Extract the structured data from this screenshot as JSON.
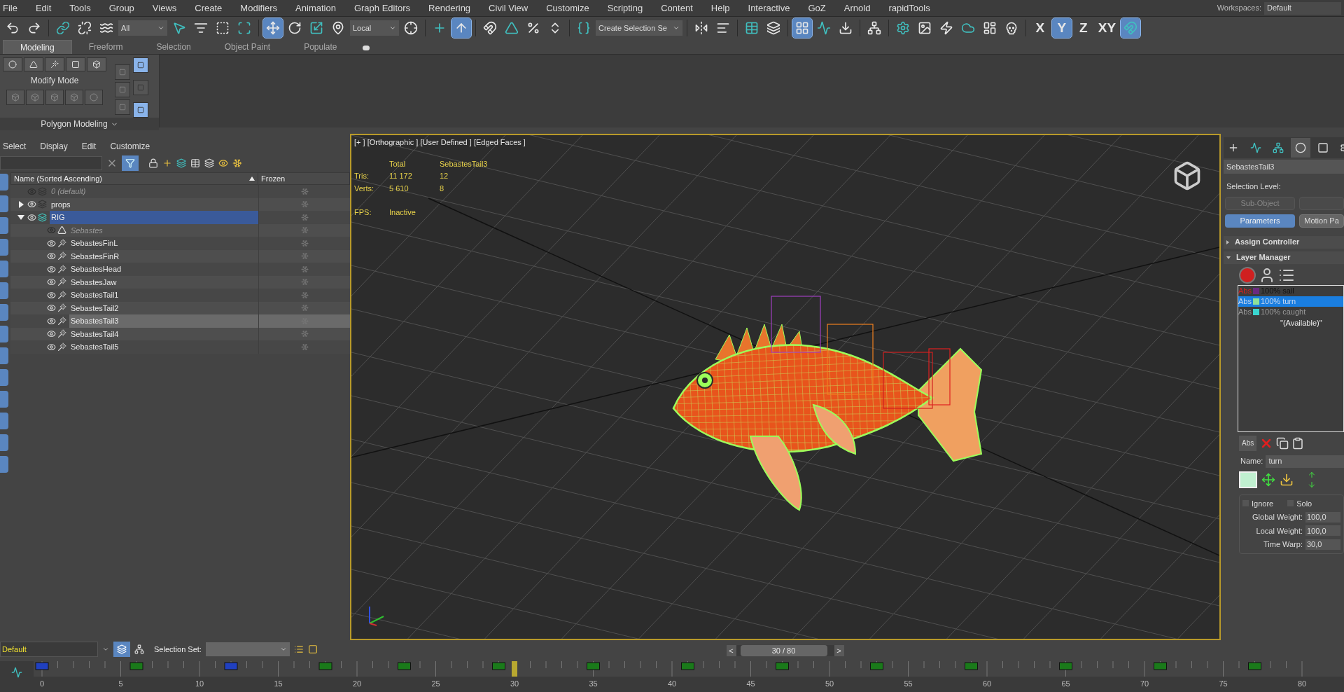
{
  "menu": [
    "File",
    "Edit",
    "Tools",
    "Group",
    "Views",
    "Create",
    "Modifiers",
    "Animation",
    "Graph Editors",
    "Rendering",
    "Civil View",
    "Customize",
    "Scripting",
    "Content",
    "Help",
    "Interactive",
    "GoZ",
    "Arnold",
    "rapidTools"
  ],
  "workspace": {
    "label": "Workspaces:",
    "value": "Default"
  },
  "toolbar": {
    "groups": [
      [
        {
          "kind": "button",
          "selected": false
        },
        {
          "kind": "button",
          "selected": false
        }
      ],
      [
        {
          "kind": "button",
          "selected": false
        },
        {
          "kind": "button",
          "selected": false
        },
        {
          "kind": "button",
          "selected": false
        },
        {
          "kind": "dropdown",
          "value": "All"
        },
        {
          "kind": "button",
          "selected": false
        },
        {
          "kind": "button",
          "selected": false
        },
        {
          "kind": "button",
          "selected": false
        },
        {
          "kind": "button",
          "selected": false
        }
      ],
      [
        {
          "kind": "button",
          "selected": true
        },
        {
          "kind": "button",
          "selected": false
        },
        {
          "kind": "button",
          "selected": false
        },
        {
          "kind": "button",
          "selected": false
        },
        {
          "kind": "dropdown",
          "value": "Local"
        },
        {
          "kind": "button",
          "selected": false
        }
      ],
      [
        {
          "kind": "button",
          "selected": false
        },
        {
          "kind": "button",
          "selected": true
        }
      ],
      [
        {
          "kind": "button",
          "selected": false
        },
        {
          "kind": "button",
          "selected": false
        },
        {
          "kind": "button",
          "selected": false
        },
        {
          "kind": "button",
          "selected": false
        }
      ],
      [
        {
          "kind": "button",
          "selected": false
        },
        {
          "kind": "dropdown",
          "value": "Create Selection Se"
        }
      ],
      [
        {
          "kind": "button",
          "selected": false
        },
        {
          "kind": "button",
          "selected": false
        }
      ],
      [
        {
          "kind": "button",
          "selected": false
        },
        {
          "kind": "button",
          "selected": false
        }
      ],
      [
        {
          "kind": "button",
          "selected": true
        },
        {
          "kind": "button",
          "selected": false
        },
        {
          "kind": "button",
          "selected": false
        }
      ],
      [
        {
          "kind": "button",
          "selected": false
        }
      ],
      [
        {
          "kind": "button",
          "selected": false
        },
        {
          "kind": "button",
          "selected": false
        },
        {
          "kind": "button",
          "selected": false
        },
        {
          "kind": "button",
          "selected": false
        },
        {
          "kind": "button",
          "selected": false
        },
        {
          "kind": "button",
          "selected": false
        }
      ],
      [
        {
          "kind": "axis",
          "label": "X",
          "selected": false
        },
        {
          "kind": "axis",
          "label": "Y",
          "selected": true
        },
        {
          "kind": "axis",
          "label": "Z",
          "selected": false
        },
        {
          "kind": "axis",
          "label": "XY",
          "selected": false
        },
        {
          "kind": "button",
          "selected": true
        }
      ]
    ]
  },
  "ribbon": {
    "tabs": [
      {
        "label": "Modeling",
        "selected": true
      },
      {
        "label": "Freeform",
        "selected": false
      },
      {
        "label": "Selection",
        "selected": false
      },
      {
        "label": "Object Paint",
        "selected": false
      },
      {
        "label": "Populate",
        "selected": false
      }
    ],
    "panel_label": "Modify Mode",
    "panel_title": "Polygon Modeling"
  },
  "explorer": {
    "menu": [
      "Select",
      "Display",
      "Edit",
      "Customize"
    ],
    "filter_selected": true,
    "columns": [
      "Name (Sorted Ascending)",
      "Frozen"
    ],
    "tree": [
      {
        "name": "0 (default)",
        "kind": "layer",
        "visible": false,
        "selected": false
      },
      {
        "name": "props",
        "kind": "layer",
        "visible": true,
        "selected": false,
        "expanded": false
      },
      {
        "name": "RIG",
        "kind": "layer",
        "visible": true,
        "selected": true,
        "expanded": true,
        "children": [
          {
            "name": "Sebastes",
            "kind": "root",
            "visible": false,
            "selected": false
          },
          {
            "name": "SebastesFinL",
            "kind": "bone",
            "visible": true,
            "selected": false
          },
          {
            "name": "SebastesFinR",
            "kind": "bone",
            "visible": true,
            "selected": false
          },
          {
            "name": "SebastesHead",
            "kind": "bone",
            "visible": true,
            "selected": false
          },
          {
            "name": "SebastesJaw",
            "kind": "bone",
            "visible": true,
            "selected": false
          },
          {
            "name": "SebastesTail1",
            "kind": "bone",
            "visible": true,
            "selected": false
          },
          {
            "name": "SebastesTail2",
            "kind": "bone",
            "visible": true,
            "selected": false
          },
          {
            "name": "SebastesTail3",
            "kind": "bone",
            "visible": true,
            "selected": true
          },
          {
            "name": "SebastesTail4",
            "kind": "bone",
            "visible": true,
            "selected": false
          },
          {
            "name": "SebastesTail5",
            "kind": "bone",
            "visible": true,
            "selected": false
          }
        ]
      }
    ]
  },
  "layer_bar": {
    "layer": "Default",
    "selection_set_label": "Selection Set:"
  },
  "viewport": {
    "label": "[+ ] [Orthographic ] [User Defined ] [Edged Faces ]",
    "stats": {
      "headers": [
        "Total",
        "SebastesTail3"
      ],
      "rows": [
        {
          "label": "Tris:",
          "values": [
            "11 172",
            "12"
          ]
        },
        {
          "label": "Verts:",
          "values": [
            "5 610",
            "8"
          ]
        }
      ],
      "fps_label": "FPS:",
      "fps": "Inactive"
    }
  },
  "time_slider": {
    "text": "30 / 80",
    "level": 0.375,
    "prev": "<",
    "next": ">"
  },
  "timeline": {
    "labels": [
      "0",
      "5",
      "10",
      "15",
      "20",
      "25",
      "30",
      "35",
      "40",
      "45",
      "50",
      "55",
      "60",
      "65",
      "70",
      "75",
      "80"
    ]
  },
  "command_panel": {
    "tabs": [
      {
        "selected": false
      },
      {
        "selected": false
      },
      {
        "selected": false
      },
      {
        "selected": true
      },
      {
        "selected": false
      },
      {
        "selected": false
      }
    ],
    "object_name": "SebastesTail3",
    "selection_level": "Selection Level:",
    "buttons": [
      {
        "label": "Sub-Object",
        "selected": false,
        "disabled": true
      },
      {
        "selected": false,
        "disabled": true
      },
      {
        "label": "Parameters",
        "selected": true,
        "disabled": false
      },
      {
        "label": "Motion Pa",
        "selected": false,
        "disabled": false
      }
    ],
    "rollouts": [
      {
        "title": "Assign Controller",
        "expanded": false
      },
      {
        "title": "Layer Manager",
        "expanded": true
      }
    ],
    "layers": [
      {
        "mode": "Abs",
        "color": "#6a2a80",
        "label": "100% sail",
        "selected": false,
        "disabled": false
      },
      {
        "mode": "Abs",
        "color": "#8ee09a",
        "label": "100% turn",
        "selected": true,
        "disabled": false
      },
      {
        "mode": "Abs",
        "color": "#3ad6d0",
        "label": "100% caught",
        "selected": false,
        "disabled": true
      }
    ],
    "available": "\"(Available)\"",
    "abs_button": "Abs",
    "name_label": "Name:",
    "name_value": "turn",
    "ignore": {
      "label": "Ignore",
      "checked": false
    },
    "solo": {
      "label": "Solo",
      "checked": false
    },
    "spinners": [
      {
        "label": "Global Weight:",
        "value": "100,0"
      },
      {
        "label": "Local Weight:",
        "value": "100,0"
      },
      {
        "label": "Time Warp:",
        "value": "30,0"
      }
    ]
  }
}
